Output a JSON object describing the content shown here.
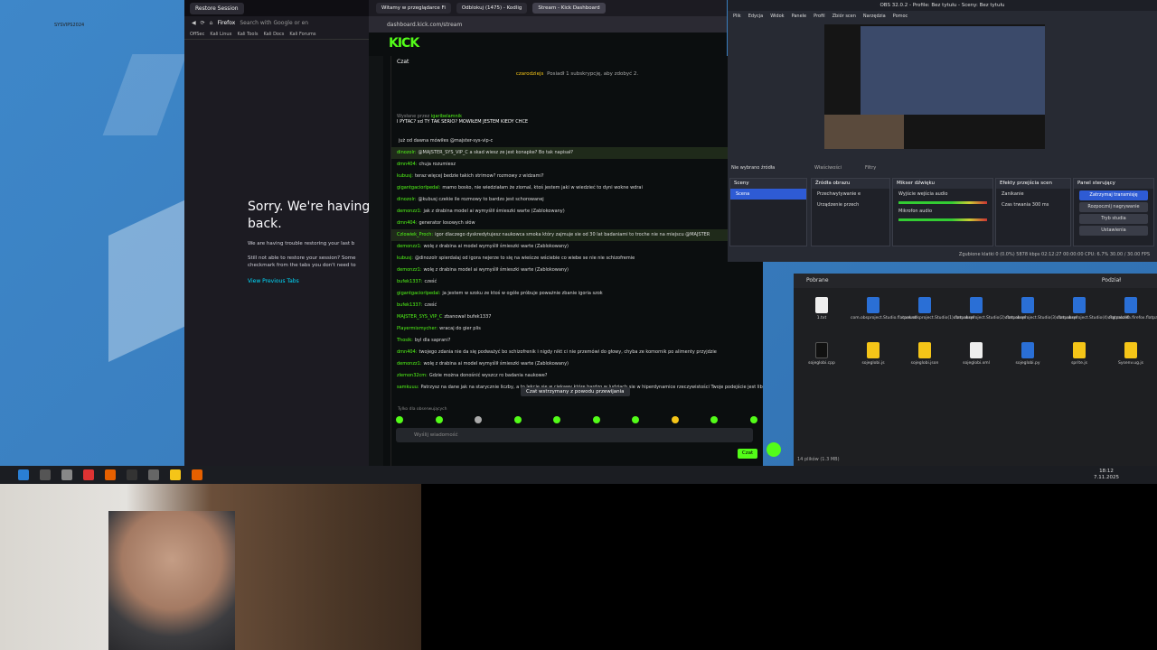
{
  "desktop": {
    "label": "SYSVIPS2024"
  },
  "firefox": {
    "tab": "Restore Session",
    "nav_tab": "Firefox",
    "search_placeholder": "Search with Google or en",
    "bookmarks": [
      "OffSec",
      "Kali Linux",
      "Kali Tools",
      "Kali Docs",
      "Kali Forums"
    ],
    "sorry_title": "Sorry. We're having back.",
    "sorry_p1": "We are having trouble restoring your last b",
    "sorry_p2": "Still not able to restore your session? Some checkmark from the tabs you don't need to",
    "view_tabs": "View Previous Tabs"
  },
  "kick": {
    "tabs": [
      "Witamy w przeglądarce Fi",
      "Odblokuj (1475) - Kodlig",
      "Stream - Kick Dashboard"
    ],
    "url": "dashboard.kick.com/stream",
    "logo": "KICK",
    "chat_header": "Czat",
    "pinned_user": "czarodziejs",
    "pinned_text": "Posiadł 1 subskrypcję, aby zdobyć 2.",
    "replying_to": "Wysłane przez",
    "replying_user": "igaribelamnik",
    "replying_text": "I PYTAC? xd TY TAK SERIO? MOWIŁEM JESTEM KIEDY CHCE",
    "messages": [
      {
        "user": "",
        "text": "już od dawna mówiłes @majster-sys-vip-c"
      },
      {
        "user": "dinozolr:",
        "text": "@MAJSTER_SYS_VIP_C a skad wiesz ze jest konapke? Bo tak napisał?"
      },
      {
        "user": "dmn404:",
        "text": "chuja rozumiesz"
      },
      {
        "user": "kubusj:",
        "text": "teraz więcej bedzie takich strimow? rozmowy z widzami?"
      },
      {
        "user": "gigantgaciorlpedal:",
        "text": "mamo bosko, nie wiedziałam że ziomal, ktoś jestem jaki w wiedzieć to dyni wokne wdrai"
      },
      {
        "user": "dinozolr:",
        "text": "@kubusj czekie ile rozmowy to bardzo jest schorowanej"
      },
      {
        "user": "demonzz1:",
        "text": "jak z drabina model ai wymyślił śmieszki warte (Zablokowany)"
      },
      {
        "user": "dmn404:",
        "text": "generator losowych słów"
      },
      {
        "user": "Czlowiek_Proch:",
        "text": "igor dlaczego dyskredytujesz naukowca smoka który zajmuje sie od 30 lat badaniami to troche nie na miejscu @MAJSTER"
      },
      {
        "user": "demonzz1:",
        "text": "wolę z drabina ai model wymyślił śmieszki warte (Zablokowany)"
      },
      {
        "user": "kubusj:",
        "text": "@dinozolr spierdalaj od igora nejerze to się na wieścze wściebie co wiebe se nie nie schizofremie"
      },
      {
        "user": "demonzz1:",
        "text": "wolę z drabina model ai wymyślił śmieszki warte (Zablokowany)"
      },
      {
        "user": "bufek1337:",
        "text": "cześć"
      },
      {
        "user": "gigantgaciorlpedal:",
        "text": "ja jestem w szoku ze ktoś w ogóle próbuje poważnie zbanie igoria szok"
      },
      {
        "user": "bufek1337:",
        "text": "cześć"
      },
      {
        "user": "MAJSTER_SYS_VIP_C",
        "text": "zbanował bufek1337"
      },
      {
        "user": "Playermixmycher:",
        "text": "wracaj do gier plis"
      },
      {
        "user": "Thosik:",
        "text": "byl dla saprani?"
      },
      {
        "user": "dmn404:",
        "text": "twojego zdania nie da się podważyć bo schizofrenik i nigdy nikt ci nie przemówi do głowy, chyba ze komornik po alimenty przyjdzie"
      },
      {
        "user": "demonzz1:",
        "text": "wolę z drabina ai model wymyślił śmieszki warte (Zablokowany)"
      },
      {
        "user": "zlemon32cm:",
        "text": "Gdzie można donośnić wyszcz ro badania naukowe?"
      },
      {
        "user": "samkuuu:",
        "text": "Patrzysz na dane jak na starycznie liczby, a to lekcje się w ciekawy które bardzo w ludziach sie w hiperdynamice rzeczywistości Twoje podejście jest liberalna fantazją w świecie mierności, które może jest wciśnięte od w tysiące pozornych scenariuszy"
      }
    ],
    "paused": "Czat wstrzymany z powodu przewijania",
    "subs_only": "Tylko dla obserwujących",
    "input_placeholder": "Wyślij wiadomość",
    "send_button": "Czat"
  },
  "obs": {
    "title": "OBS 32.0.2 - Profile: Bez tytułu - Sceny: Bez tytułu",
    "menu": [
      "Plik",
      "Edycja",
      "Widok",
      "Panele",
      "Profil",
      "Zbiór scen",
      "Narzędzia",
      "Pomoc"
    ],
    "no_source": "Nie wybrano źródła",
    "props": "Właściwości",
    "filters": "Filtry",
    "docks": {
      "scenes": {
        "title": "Sceny",
        "items": [
          "Scena"
        ]
      },
      "sources": {
        "title": "Źródła obrazu",
        "items": [
          "Przechwytywanie e",
          "Urządzenie przech"
        ]
      },
      "mixer": {
        "title": "Mikser dźwięku",
        "items": [
          "Wyjście wejścia audio",
          "Mikrofon audio"
        ]
      },
      "transitions": {
        "title": "Efekty przejścia scen",
        "fade": "Zanikanie",
        "duration_label": "Czas trwania",
        "duration": "300 ms"
      },
      "controls": {
        "title": "Panel sterujący",
        "buttons": [
          "Zatrzymaj transmisję",
          "Rozpocznij nagrywanie",
          "Tryb studia",
          "Ustawienia"
        ]
      }
    },
    "status": "Zgubione klatki 0 (0.0%)   5878 kbps   02:12:27   00:00:00   CPU: 6.7%   30.00 / 30.00 FPS"
  },
  "filemanager": {
    "title": "Pobrane",
    "view": "Podział",
    "files": [
      {
        "name": "1.txt",
        "type": "w"
      },
      {
        "name": "com.obsproject.Studio.flatpakref",
        "type": "b"
      },
      {
        "name": "com.obsproject.Studio(1).flatpakref",
        "type": "b"
      },
      {
        "name": "com.obsproject.Studio(2).flatpakref",
        "type": "b"
      },
      {
        "name": "com.obsproject.Studio(3).flatpakref",
        "type": "b"
      },
      {
        "name": "com.obsproject.Studio(4).flatpakref",
        "type": "b"
      },
      {
        "name": "org.mozilla.firefox.flatpakref",
        "type": "b"
      },
      {
        "name": "sojeglobi.cpp",
        "type": "k"
      },
      {
        "name": "sojeglobi.js",
        "type": "y"
      },
      {
        "name": "sojeglobi.json",
        "type": "y"
      },
      {
        "name": "sojeglobi.xml",
        "type": "w"
      },
      {
        "name": "sojeglobi.py",
        "type": "b"
      },
      {
        "name": "sprite.js",
        "type": "y"
      },
      {
        "name": "Sysenv.ug.js",
        "type": "y"
      }
    ],
    "status": "14 plików (1.3 MB)"
  },
  "taskbar": {
    "time": "18:12",
    "date": "7.11.2025"
  },
  "colors": {
    "kick_green": "#53fc18",
    "obs_blue": "#2e5bd4",
    "firefox_link": "#00ddff"
  }
}
